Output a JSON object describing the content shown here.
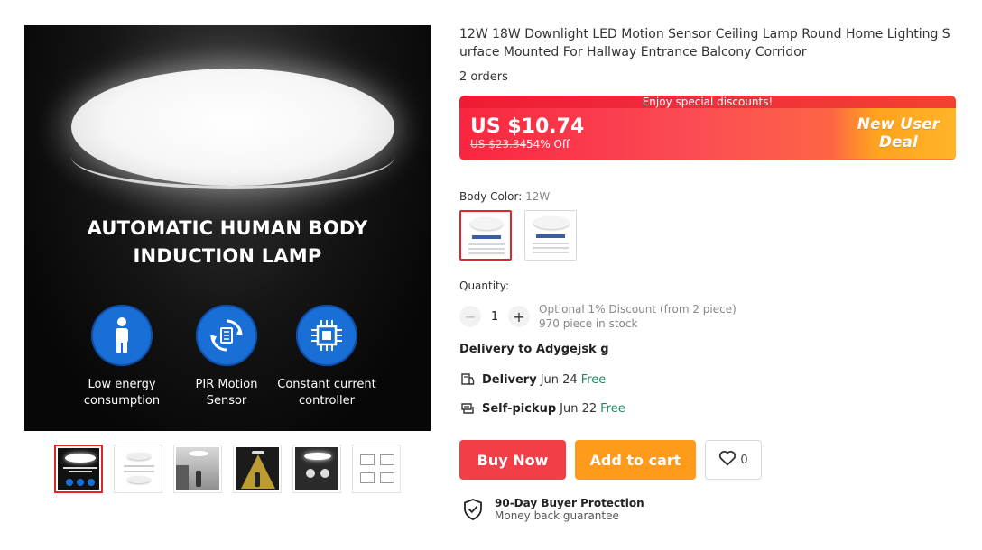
{
  "gallery": {
    "main_image": {
      "title_line1": "AUTOMATIC HUMAN BODY",
      "title_line2": "INDUCTION LAMP",
      "features": [
        {
          "icon": "person-icon",
          "line1": "Low energy",
          "line2": "consumption"
        },
        {
          "icon": "refresh-sensor-icon",
          "line1": "PIR Motion",
          "line2": "Sensor"
        },
        {
          "icon": "chip-icon",
          "line1": "Constant current",
          "line2": "controller"
        }
      ],
      "accent_color": "#1a6fd6"
    },
    "thumbnails_count": 6,
    "active_thumbnail": 1
  },
  "product": {
    "title": "12W 18W Downlight LED Motion Sensor Ceiling Lamp Round Home Lighting Surface Mounted For Hallway Entrance Balcony Corridor",
    "orders": "2 orders"
  },
  "price": {
    "promo_label": "Enjoy special discounts!",
    "current": "US $10.74",
    "original": "US $23.34",
    "discount": "54% Off",
    "deal_line1": "New User",
    "deal_line2": "Deal",
    "colors": {
      "banner_start": "#f9263f",
      "banner_end": "#ff7a3a",
      "deal": "#ffa21f"
    }
  },
  "options": {
    "color_label": "Body Color:",
    "color_value": "12W",
    "color_choices": 2,
    "selected_choice": 1
  },
  "quantity": {
    "label": "Quantity:",
    "minus": "−",
    "plus": "+",
    "value": "1",
    "discount_note": "Optional 1% Discount (from 2 piece)",
    "stock": "970 piece in stock"
  },
  "delivery": {
    "to_label": "Delivery to Adygejsk g",
    "rows": [
      {
        "icon": "delivery-icon",
        "label": "Delivery",
        "date": "Jun 24",
        "price": "Free"
      },
      {
        "icon": "pickup-icon",
        "label": "Self-pickup",
        "date": "Jun 22",
        "price": "Free"
      }
    ],
    "free_color": "#1f8a5b"
  },
  "actions": {
    "buy_now": "Buy Now",
    "add_to_cart": "Add to cart",
    "wishlist_count": "0"
  },
  "protection": {
    "title": "90-Day Buyer Protection",
    "subtitle": "Money back guarantee"
  }
}
